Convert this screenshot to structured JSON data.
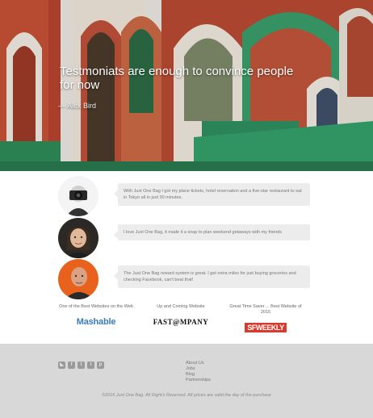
{
  "hero": {
    "quote": "Testmoniats are enough to convince people for now",
    "author": "— Alex Bird"
  },
  "testimonials": [
    {
      "text": "With Just One Bag I got my plane tickets, hotel reservation and a five-star restaurant to eat in Tokyo all in just 30 minutes."
    },
    {
      "text": "I love Just One Bag, it made it a snap to plan weekend getaways with my friends"
    },
    {
      "text": "The Just One Bag reward system is great. I get extra miles for just buying groceries and checking Facebook, can't beat that!"
    }
  ],
  "press": [
    {
      "caption": "One of the Best Websites on the Web",
      "logo": "Mashable"
    },
    {
      "caption": "Up and Coming Website",
      "logo": "FAST@MPANY"
    },
    {
      "caption": "Great Time Saver ... Best Website of 2015",
      "logo": "SFWEEKLY"
    }
  ],
  "footer": {
    "social_icons": [
      "rss-icon",
      "facebook-icon",
      "twitter-icon",
      "tumblr-icon",
      "pinterest-icon"
    ],
    "social_glyphs": [
      "◣",
      "f",
      "t",
      "t",
      "p"
    ],
    "links": [
      "About Us",
      "Jobs",
      "Blog",
      "Partnerships"
    ],
    "copyright": "©2015 Just One Bag. All Right's Reserved. All prices are valid the day of the purchase"
  },
  "colors": {
    "footer_bg": "#d8d8d8",
    "bubble_bg": "#ececec",
    "mashable": "#3a7bb7",
    "sfweekly": "#d63b2f"
  }
}
